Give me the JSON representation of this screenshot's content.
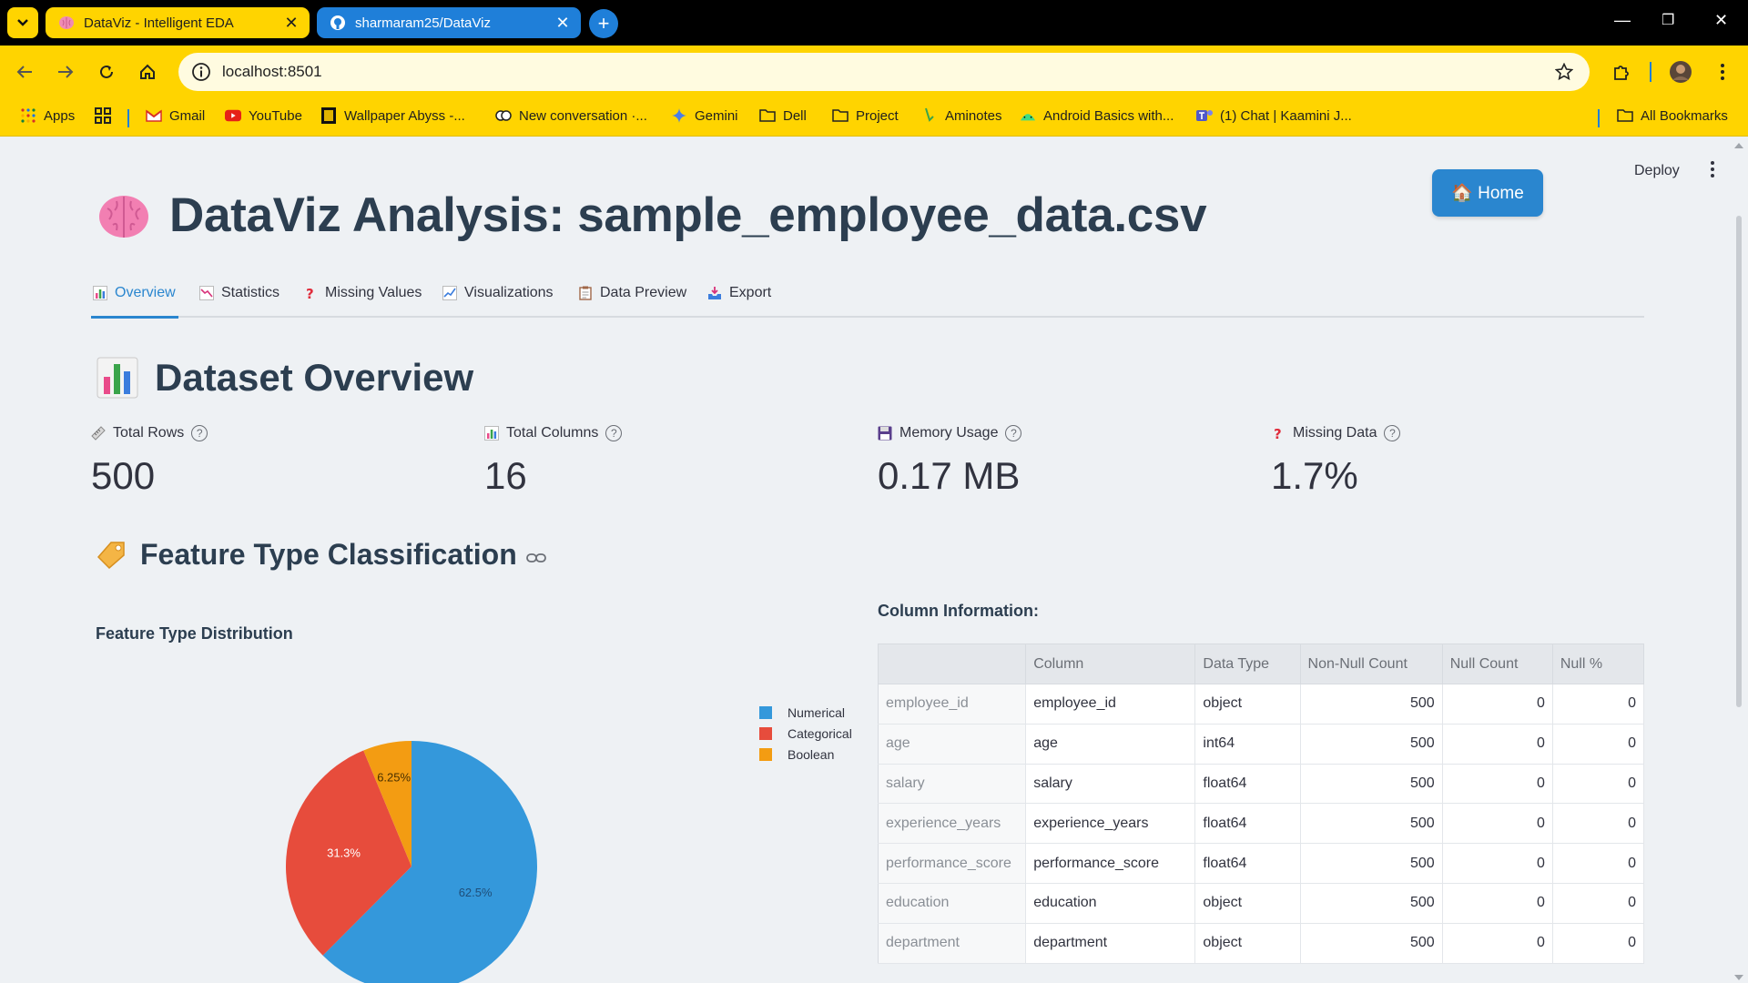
{
  "browser": {
    "tabs": [
      {
        "title": "DataViz - Intelligent EDA",
        "icon": "brain-icon",
        "active": true
      },
      {
        "title": "sharmaram25/DataViz",
        "icon": "github-icon",
        "active": false
      }
    ],
    "url": "localhost:8501",
    "bookmarks": [
      {
        "label": "Apps",
        "icon": "apps-grid-icon"
      },
      {
        "label": "Gmail",
        "icon": "gmail-icon"
      },
      {
        "label": "YouTube",
        "icon": "youtube-icon"
      },
      {
        "label": "Wallpaper Abyss -...",
        "icon": "wallpaper-icon"
      },
      {
        "label": "New conversation ·...",
        "icon": "copilot-icon"
      },
      {
        "label": "Gemini",
        "icon": "gemini-icon"
      },
      {
        "label": "Dell",
        "icon": "folder-icon"
      },
      {
        "label": "Project",
        "icon": "folder-icon"
      },
      {
        "label": "Aminotes",
        "icon": "aminotes-icon"
      },
      {
        "label": "Android Basics with...",
        "icon": "android-icon"
      },
      {
        "label": "(1) Chat | Kaamini J...",
        "icon": "teams-icon"
      }
    ],
    "all_bookmarks": "All Bookmarks"
  },
  "app": {
    "deploy_label": "Deploy",
    "home_button": "🏠 Home",
    "title": "DataViz Analysis: sample_employee_data.csv",
    "tabs": [
      {
        "label": "Overview",
        "icon": "bar-chart-icon"
      },
      {
        "label": "Statistics",
        "icon": "chart-down-icon"
      },
      {
        "label": "Missing Values",
        "icon": "question-icon"
      },
      {
        "label": "Visualizations",
        "icon": "chart-up-icon"
      },
      {
        "label": "Data Preview",
        "icon": "clipboard-icon"
      },
      {
        "label": "Export",
        "icon": "inbox-icon"
      }
    ],
    "overview_heading": "Dataset Overview",
    "metrics": [
      {
        "label": "Total Rows",
        "value": "500",
        "icon": "ruler-icon"
      },
      {
        "label": "Total Columns",
        "value": "16",
        "icon": "bar-chart-icon"
      },
      {
        "label": "Memory Usage",
        "value": "0.17 MB",
        "icon": "floppy-disk-icon"
      },
      {
        "label": "Missing Data",
        "value": "1.7%",
        "icon": "question-icon"
      }
    ],
    "feature_heading": "Feature Type Classification",
    "column_info_title": "Column Information:",
    "table": {
      "headers": [
        "",
        "Column",
        "Data Type",
        "Non-Null Count",
        "Null Count",
        "Null %"
      ],
      "rows": [
        [
          "employee_id",
          "employee_id",
          "object",
          "500",
          "0",
          "0"
        ],
        [
          "age",
          "age",
          "int64",
          "500",
          "0",
          "0"
        ],
        [
          "salary",
          "salary",
          "float64",
          "500",
          "0",
          "0"
        ],
        [
          "experience_years",
          "experience_years",
          "float64",
          "500",
          "0",
          "0"
        ],
        [
          "performance_score",
          "performance_score",
          "float64",
          "500",
          "0",
          "0"
        ],
        [
          "education",
          "education",
          "object",
          "500",
          "0",
          "0"
        ],
        [
          "department",
          "department",
          "object",
          "500",
          "0",
          "0"
        ]
      ]
    }
  },
  "chart_data": {
    "type": "pie",
    "title": "Feature Type Distribution",
    "categories": [
      "Numerical",
      "Categorical",
      "Boolean"
    ],
    "values": [
      62.5,
      31.3,
      6.25
    ],
    "labels": [
      "62.5%",
      "31.3%",
      "6.25%"
    ],
    "colors": [
      "#3498db",
      "#e74c3c",
      "#f39c12"
    ],
    "legend": "top-right"
  }
}
